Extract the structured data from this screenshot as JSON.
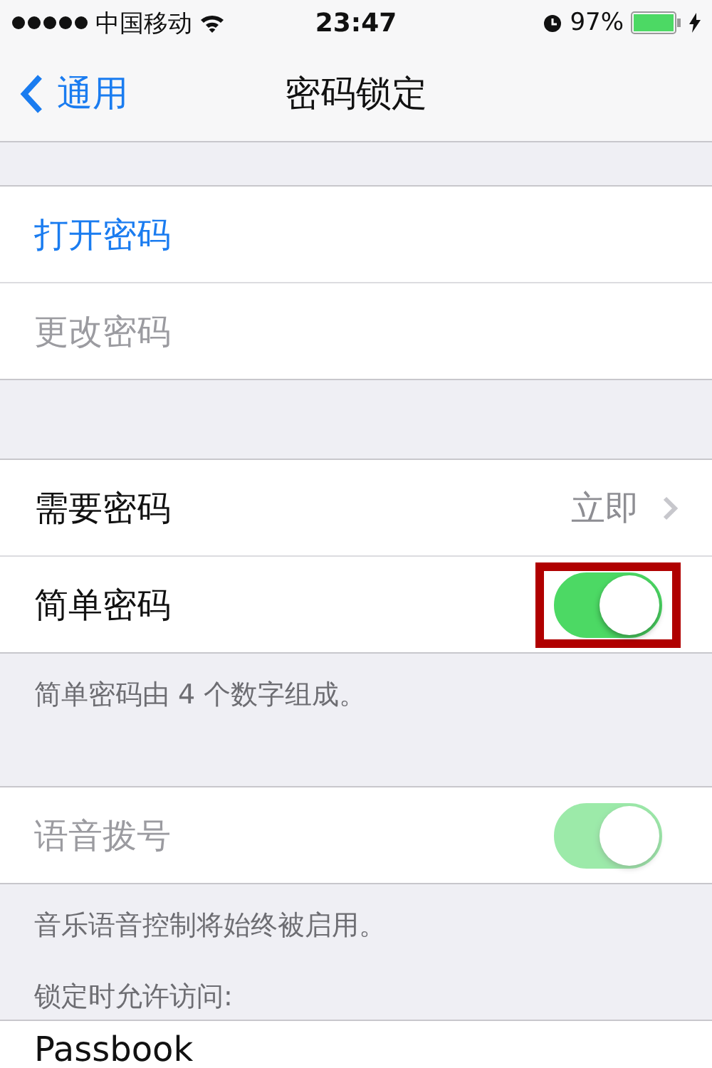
{
  "status_bar": {
    "carrier": "中国移动",
    "time": "23:47",
    "battery": "97%"
  },
  "nav": {
    "back": "通用",
    "title": "密码锁定"
  },
  "groups": [
    {
      "rows": [
        {
          "kind": "link",
          "label": "打开密码",
          "disabled": false
        },
        {
          "kind": "link",
          "label": "更改密码",
          "disabled": true
        }
      ]
    },
    {
      "rows": [
        {
          "kind": "value",
          "label": "需要密码",
          "value": "立即"
        },
        {
          "kind": "toggle",
          "label": "简单密码",
          "on": true,
          "disabled": false,
          "highlighted": true
        }
      ],
      "footer": "简单密码由 4 个数字组成。"
    },
    {
      "rows": [
        {
          "kind": "toggle",
          "label": "语音拨号",
          "on": true,
          "disabled": true,
          "highlighted": false
        }
      ],
      "footer": "音乐语音控制将始终被启用。"
    },
    {
      "header": "锁定时允许访问:",
      "rows": [
        {
          "kind": "plain",
          "label": "Passbook"
        }
      ]
    }
  ]
}
